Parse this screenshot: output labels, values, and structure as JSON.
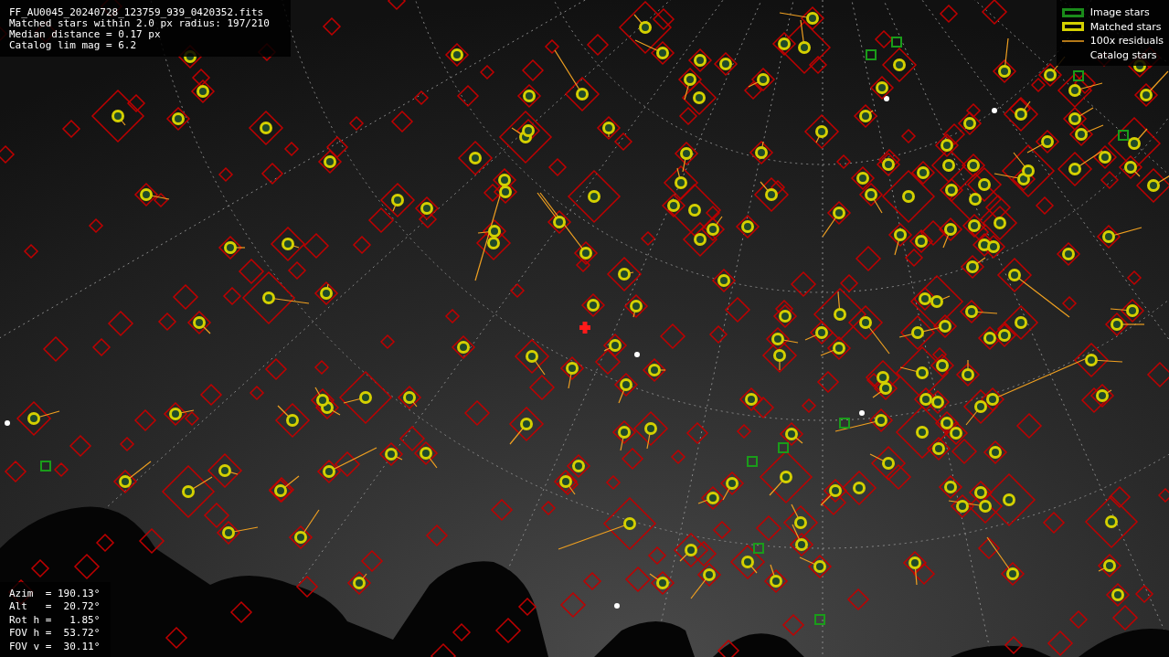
{
  "info_box": {
    "lines": [
      "FF_AU0045_20240728_123759_939_0420352.fits",
      "Matched stars within 2.0 px radius: 197/210",
      "Median distance = 0.17 px",
      "Catalog lim mag = 6.2"
    ]
  },
  "legend": {
    "items": [
      {
        "kind": "image",
        "label": "Image stars"
      },
      {
        "kind": "matched",
        "label": "Matched stars"
      },
      {
        "kind": "residuals",
        "label": "100x residuals"
      },
      {
        "kind": "catalog",
        "label": "Catalog stars"
      }
    ]
  },
  "pointing": {
    "lines": [
      "Azim  = 190.13°",
      "Alt   =  20.72°",
      "Rot h =   1.85°",
      "FOV h =  53.72°",
      "FOV v =  30.11°"
    ]
  }
}
